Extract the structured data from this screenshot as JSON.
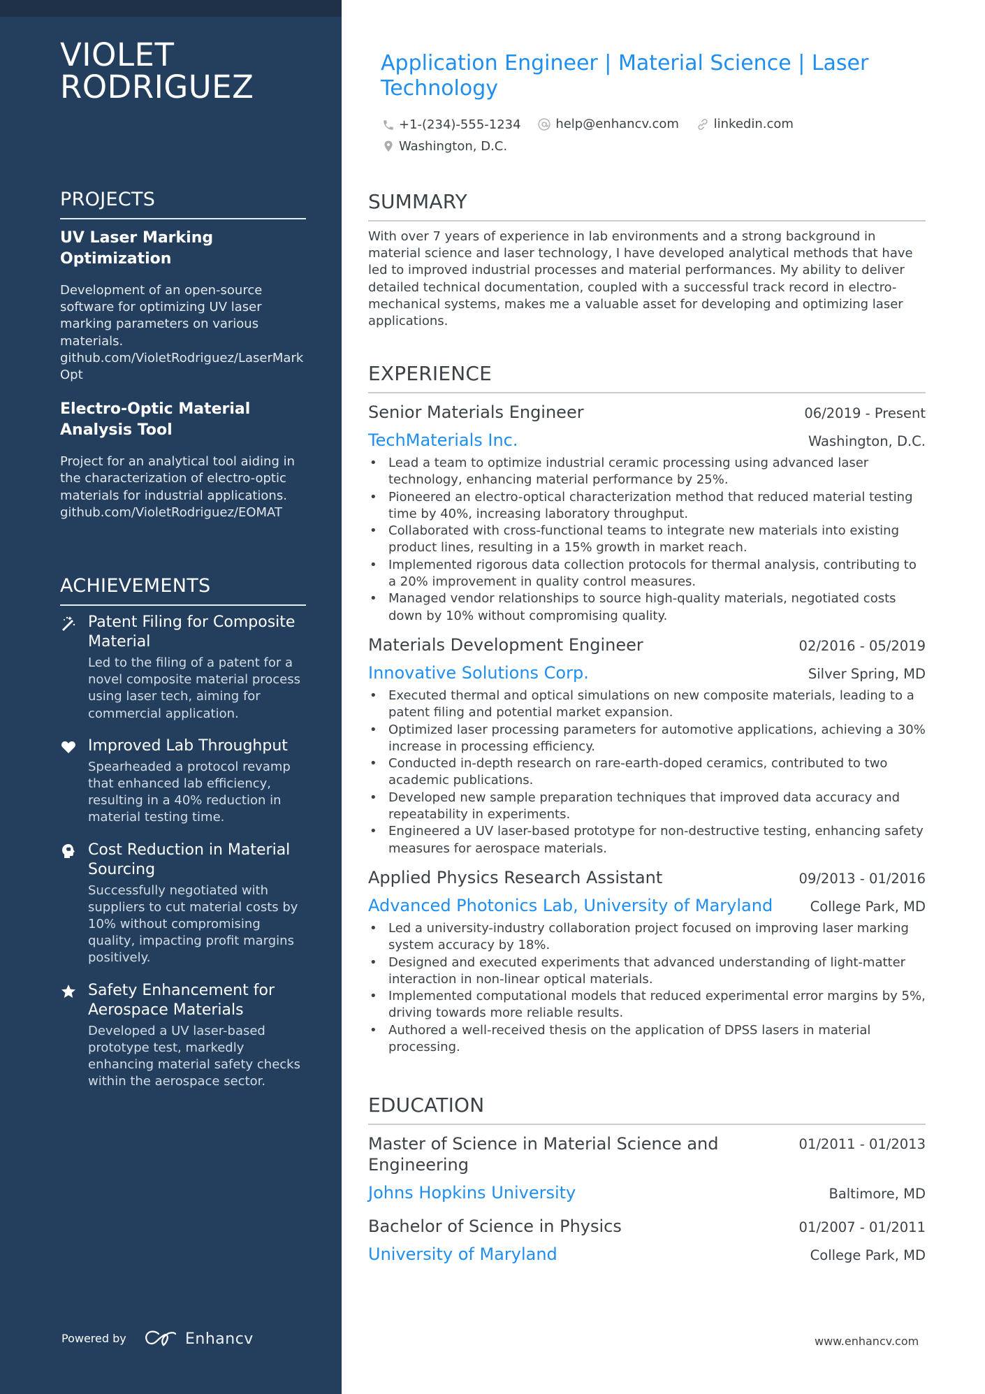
{
  "colors": {
    "sidebar": "#233f5d",
    "accent": "#1e8ef0",
    "text": "#3a4247"
  },
  "name": "VIOLET RODRIGUEZ",
  "headline": "Application Engineer | Material Science | Laser Technology",
  "contacts": {
    "phone": {
      "icon": "phone-icon",
      "text": "+1-(234)-555-1234"
    },
    "email": {
      "icon": "at-icon",
      "text": "help@enhancv.com"
    },
    "linkedin": {
      "icon": "link-icon",
      "text": "linkedin.com"
    },
    "location": {
      "icon": "map-pin-icon",
      "text": "Washington, D.C."
    }
  },
  "sidebar": {
    "projects_heading": "PROJECTS",
    "projects": [
      {
        "title": "UV Laser Marking Optimization",
        "description": "Development of an open-source software for optimizing UV laser marking parameters on various materials.",
        "link": "github.com/VioletRodriguez/LaserMarkOpt"
      },
      {
        "title": "Electro-Optic Material Analysis Tool",
        "description": "Project for an analytical tool aiding in the characterization of electro-optic materials for industrial applications.",
        "link": "github.com/VioletRodriguez/EOMAT"
      }
    ],
    "achievements_heading": "ACHIEVEMENTS",
    "achievements": [
      {
        "icon": "magic-wand-icon",
        "title": "Patent Filing for Composite Material",
        "description": "Led to the filing of a patent for a novel composite material process using laser tech, aiming for commercial application."
      },
      {
        "icon": "heart-icon",
        "title": "Improved Lab Throughput",
        "description": "Spearheaded a protocol revamp that enhanced lab efficiency, resulting in a 40% reduction in material testing time."
      },
      {
        "icon": "brain-head-icon",
        "title": "Cost Reduction in Material Sourcing",
        "description": "Successfully negotiated with suppliers to cut material costs by 10% without compromising quality, impacting profit margins positively."
      },
      {
        "icon": "star-icon",
        "title": "Safety Enhancement for Aerospace Materials",
        "description": "Developed a UV laser-based prototype test, markedly enhancing material safety checks within the aerospace sector."
      }
    ],
    "powered_by": "Powered by",
    "brand": "Enhancv"
  },
  "summary": {
    "heading": "SUMMARY",
    "text": "With over 7 years of experience in lab environments and a strong background in material science and laser technology, I have developed analytical methods that have led to improved industrial processes and material performances. My ability to deliver detailed technical documentation, coupled with a successful track record in electro-mechanical systems, makes me a valuable asset for developing and optimizing laser applications."
  },
  "experience": {
    "heading": "EXPERIENCE",
    "jobs": [
      {
        "title": "Senior Materials Engineer",
        "dates": "06/2019 - Present",
        "company": "TechMaterials Inc.",
        "location": "Washington, D.C.",
        "bullets": [
          "Lead a team to optimize industrial ceramic processing using advanced laser technology, enhancing material performance by 25%.",
          "Pioneered an electro-optical characterization method that reduced material testing time by 40%, increasing laboratory throughput.",
          "Collaborated with cross-functional teams to integrate new materials into existing product lines, resulting in a 15% growth in market reach.",
          "Implemented rigorous data collection protocols for thermal analysis, contributing to a 20% improvement in quality control measures.",
          "Managed vendor relationships to source high-quality materials, negotiated costs down by 10% without compromising quality."
        ]
      },
      {
        "title": "Materials Development Engineer",
        "dates": "02/2016 - 05/2019",
        "company": "Innovative Solutions Corp.",
        "location": "Silver Spring, MD",
        "bullets": [
          "Executed thermal and optical simulations on new composite materials, leading to a patent filing and potential market expansion.",
          "Optimized laser processing parameters for automotive applications, achieving a 30% increase in processing efficiency.",
          "Conducted in-depth research on rare-earth-doped ceramics, contributed to two academic publications.",
          "Developed new sample preparation techniques that improved data accuracy and repeatability in experiments.",
          "Engineered a UV laser-based prototype for non-destructive testing, enhancing safety measures for aerospace materials."
        ]
      },
      {
        "title": "Applied Physics Research Assistant",
        "dates": "09/2013 - 01/2016",
        "company": "Advanced Photonics Lab, University of Maryland",
        "location": "College Park, MD",
        "bullets": [
          "Led a university-industry collaboration project focused on improving laser marking system accuracy by 18%.",
          "Designed and executed experiments that advanced understanding of light-matter interaction in non-linear optical materials.",
          "Implemented computational models that reduced experimental error margins by 5%, driving towards more reliable results.",
          "Authored a well-received thesis on the application of DPSS lasers in material processing."
        ]
      }
    ]
  },
  "education": {
    "heading": "EDUCATION",
    "items": [
      {
        "degree": "Master of Science in Material Science and Engineering",
        "dates": "01/2011 - 01/2013",
        "school": "Johns Hopkins University",
        "location": "Baltimore, MD"
      },
      {
        "degree": "Bachelor of Science in Physics",
        "dates": "01/2007 - 01/2011",
        "school": "University of Maryland",
        "location": "College Park, MD"
      }
    ]
  },
  "footer": {
    "url": "www.enhancv.com"
  }
}
